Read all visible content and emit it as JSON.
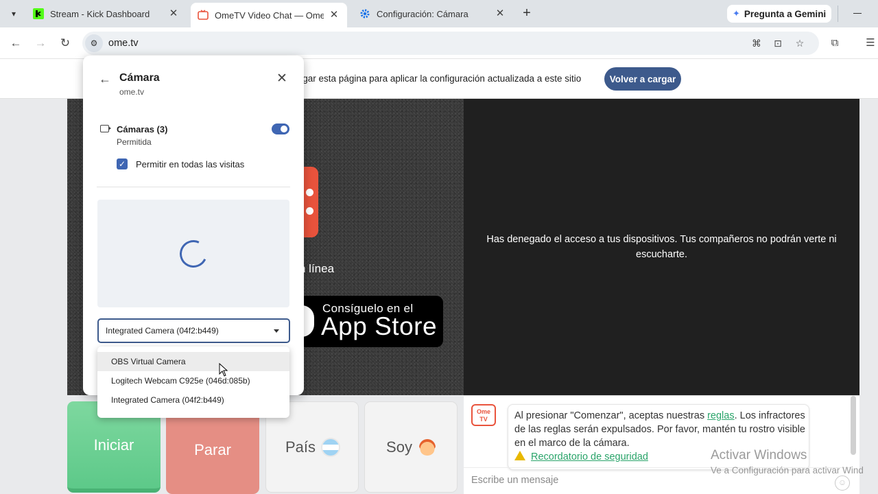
{
  "tabs": [
    {
      "title": "Stream - Kick Dashboard",
      "active": false
    },
    {
      "title": "OmeTV Video Chat — Omegle",
      "active": true
    },
    {
      "title": "Configuración: Cámara",
      "active": false
    }
  ],
  "gemini_label": "Pregunta a Gemini",
  "url": "ome.tv",
  "infobar": {
    "message": "e a cargar esta página para aplicar la configuración actualizada a este sitio",
    "reload_button": "Volver a cargar"
  },
  "camera_popup": {
    "title": "Cámara",
    "site": "ome.tv",
    "cameras_label": "Cámaras (3)",
    "cameras_status": "Permitida",
    "allow_all_visits": "Permitir en todas las visitas",
    "selected_camera": "Integrated Camera (04f2:b449)",
    "options": [
      "OBS Virtual Camera",
      "Logitech Webcam C925e (046d:085b)",
      "Integrated Camera (04f2:b449)"
    ]
  },
  "page": {
    "denied_message": "Has denegado el acceso a tus dispositivos. Tus compañeros no podrán verte ni escucharte.",
    "online_text": "n línea",
    "appstore_line1": "Consíguelo en el",
    "appstore_line2": "App Store",
    "buttons": {
      "start": "Iniciar",
      "stop": "Parar",
      "country": "País",
      "i_am": "Soy"
    },
    "chat": {
      "logo_text": "Ome TV",
      "message_before_link": "Al presionar \"Comenzar\", aceptas nuestras ",
      "rules_link": "reglas",
      "message_after_link": ". Los infractores de las reglas serán expulsados. Por favor, mantén tu rostro visible en el marco de la cámara.",
      "safety_link": "Recordatorio de seguridad",
      "input_placeholder": "Escribe un mensaje"
    }
  },
  "watermark": {
    "line1": "Activar Windows",
    "line2": "Ve a Configuración para activar Wind"
  },
  "colors": {
    "accent_blue": "#3d5a8c",
    "start_green": "#5dc989",
    "stop_red": "#e58e84",
    "ome_orange": "#e9533c"
  }
}
